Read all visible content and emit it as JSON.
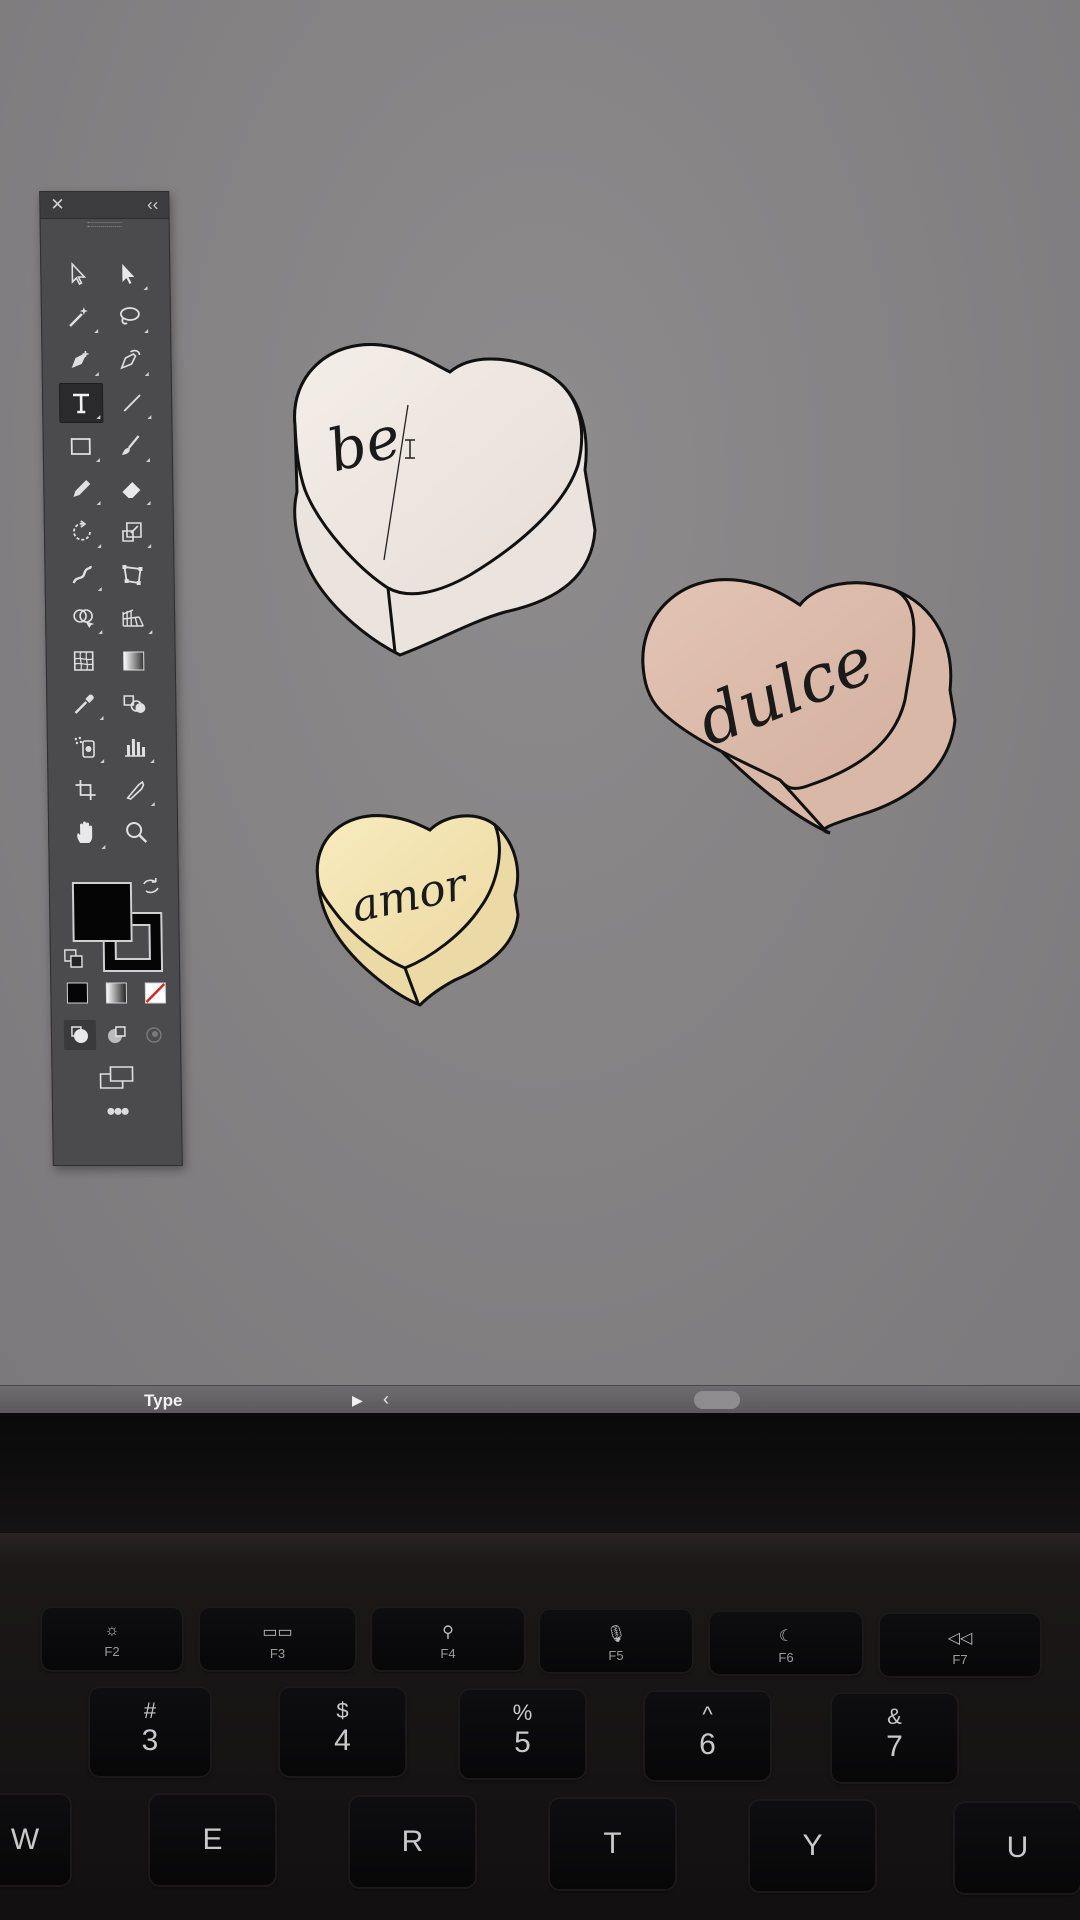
{
  "panel": {
    "close_glyph": "✕",
    "collapse_glyph": "‹‹",
    "tools": [
      [
        "selection-tool",
        "direct-selection-tool"
      ],
      [
        "magic-wand-tool",
        "lasso-tool"
      ],
      [
        "pen-tool",
        "curvature-tool"
      ],
      [
        "type-tool",
        "line-segment-tool"
      ],
      [
        "rectangle-tool",
        "paintbrush-tool"
      ],
      [
        "pencil-tool",
        "eraser-tool"
      ],
      [
        "rotate-tool",
        "scale-tool"
      ],
      [
        "warp-tool",
        "free-transform-tool"
      ],
      [
        "shape-builder-tool",
        "perspective-grid-tool"
      ],
      [
        "mesh-tool",
        "gradient-tool"
      ],
      [
        "eyedropper-tool",
        "blend-tool"
      ],
      [
        "symbol-sprayer-tool",
        "column-graph-tool"
      ],
      [
        "artboard-tool",
        "slice-tool"
      ],
      [
        "hand-tool",
        "zoom-tool"
      ]
    ],
    "active_tool": "type-tool",
    "fill_color": "#050505",
    "stroke_color": "#050505",
    "more_glyph": "•••"
  },
  "canvas": {
    "hearts": [
      {
        "name": "heart-cream",
        "text": "be",
        "color": "#efe8e3"
      },
      {
        "name": "heart-pink",
        "text": "dulce",
        "color": "#dcbcad"
      },
      {
        "name": "heart-yellow",
        "text": "amor",
        "color": "#f2e3b2"
      }
    ]
  },
  "status_bar": {
    "tool_label": "Type",
    "arrow_glyph": "▶",
    "chevron_glyph": "‹"
  },
  "keyboard": {
    "fkeys": [
      {
        "icon": "☼",
        "label": "F2"
      },
      {
        "icon": "▭▭",
        "label": "F3"
      },
      {
        "icon": "⚲",
        "label": "F4"
      },
      {
        "icon": "🎙",
        "label": "F5"
      },
      {
        "icon": "☾",
        "label": "F6"
      },
      {
        "icon": "◁◁",
        "label": "F7"
      }
    ],
    "number_keys": [
      {
        "sym": "#",
        "num": "3"
      },
      {
        "sym": "$",
        "num": "4"
      },
      {
        "sym": "%",
        "num": "5"
      },
      {
        "sym": "^",
        "num": "6"
      },
      {
        "sym": "&",
        "num": "7"
      }
    ],
    "letter_keys": [
      "W",
      "E",
      "R",
      "T",
      "Y",
      "U"
    ]
  }
}
